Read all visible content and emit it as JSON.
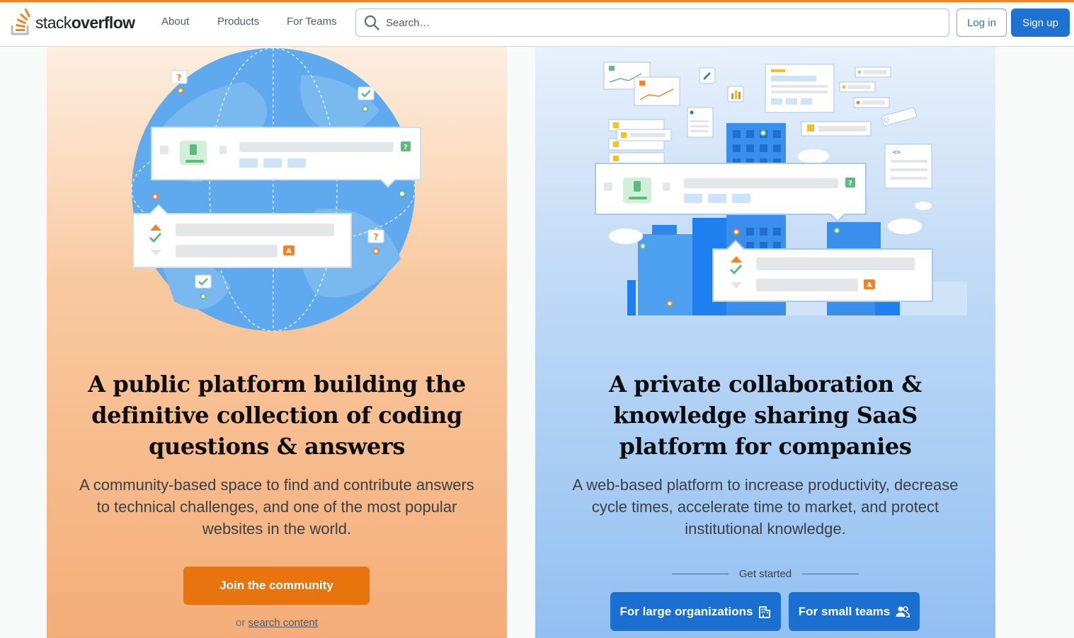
{
  "header": {
    "logo_text_light": "stack",
    "logo_text_bold": "overflow",
    "nav": [
      {
        "label": "About"
      },
      {
        "label": "Products"
      },
      {
        "label": "For Teams"
      }
    ],
    "search": {
      "placeholder": "Search…",
      "icon": "search-icon"
    },
    "login_label": "Log in",
    "signup_label": "Sign up"
  },
  "public_card": {
    "title": "A public platform building the definitive collection of coding questions & answers",
    "description": "A community-based space to find and contribute answers to technical challenges, and one of the most popular websites in the world.",
    "cta_label": "Join the community",
    "or_text": "or",
    "search_link": "search content",
    "illustration": {
      "q_badge": "?",
      "a_badge": "A"
    }
  },
  "teams_card": {
    "title": "A private collaboration & knowledge sharing SaaS platform for companies",
    "description": "A web-based platform to increase productivity, decrease cycle times, accelerate time to market, and protect institutional knowledge.",
    "get_started": "Get started",
    "large_org_label": "For large organizations",
    "large_org_icon": "building-icon",
    "small_teams_label": "For small teams",
    "small_teams_icon": "users-icon",
    "illustration": {
      "q_badge": "?",
      "a_badge": "A",
      "code_glyph": "<>"
    }
  },
  "colors": {
    "brand_orange": "#f48225",
    "cta_orange": "#e8740e",
    "brand_blue": "#1a6fd0"
  }
}
